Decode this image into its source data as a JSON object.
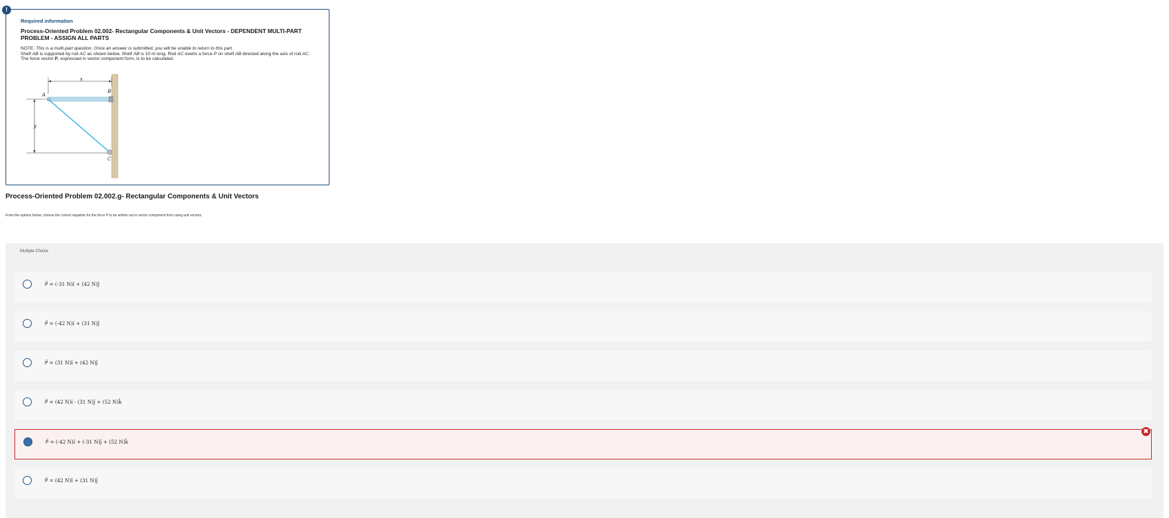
{
  "info": {
    "alert_icon": "!",
    "required_title": "Required information",
    "heading": "Process-Oriented Problem 02.002- Rectangular Components & Unit Vectors - DEPENDENT MULTI-PART PROBLEM - ASSIGN ALL PARTS",
    "note_label": "NOTE:",
    "note_text": "This is a multi-part question. Once an answer is submitted, you will be unable to return to this part.",
    "desc_a": "Shelf ",
    "desc_ab1": "AB",
    "desc_b": " is supported by rod ",
    "desc_ac1": "AC",
    "desc_c": " as shown below. Shelf ",
    "desc_ab2": "AB",
    "desc_d": " is 10 m long. Rod ",
    "desc_ac2": "AC",
    "desc_e": " exerts a force ",
    "desc_p": "P",
    "desc_f": " on shelf ",
    "desc_ab3": "AB",
    "desc_g": " directed along the axis of rod ",
    "desc_ac3": "AC",
    "desc_h": ". The force vector ",
    "desc_pbold": "P",
    "desc_i": ", expressed in vector component form, is to be calculated.",
    "figure_labels": {
      "a": "A",
      "b": "B",
      "c": "C",
      "x": "x",
      "y": "y"
    }
  },
  "question": {
    "title": "Process-Oriented Problem 02.002.g- Rectangular Components & Unit Vectors",
    "instruction": "From the options below, choose the correct equation for the force  P  to be written out in vector component form using unit vectors."
  },
  "multiple_choice": {
    "label": "Multiple Choice",
    "options": [
      {
        "text": "P⃗ = (-31 N)î + (42 N)ĵ",
        "selected": false
      },
      {
        "text": "P⃗ = (-42 N)î + (31 N)ĵ",
        "selected": false
      },
      {
        "text": "P⃗ = (31 N)î + (42 N)ĵ",
        "selected": false
      },
      {
        "text": "P⃗ = (42 N)î - (31 N)ĵ + (52 N)k̂",
        "selected": false
      },
      {
        "text": "P⃗ = (-42 N)î + (-31 N)ĵ + (52 N)k̂",
        "selected": true
      },
      {
        "text": "P⃗ = (42 N)î + (31 N)ĵ",
        "selected": false
      }
    ],
    "incorrect_icon": "✖"
  },
  "colors": {
    "accent": "#1f4e79",
    "error": "#c62828",
    "rod": "#29aee6"
  }
}
